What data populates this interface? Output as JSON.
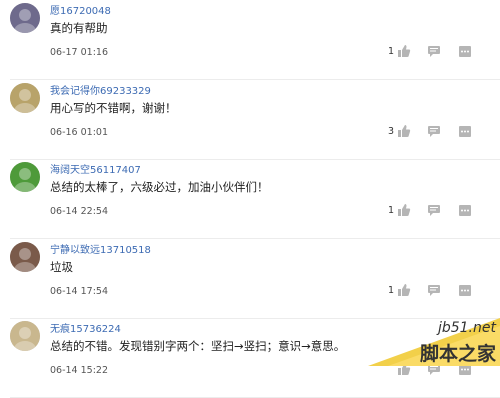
{
  "comments": [
    {
      "username": "愿16720048",
      "content": "真的有帮助",
      "time": "06-17 01:16",
      "likes": "1",
      "avatar_color": "#6e6a8c"
    },
    {
      "username": "我会记得你69233329",
      "content": "用心写的不错啊，谢谢！",
      "time": "06-16 01:01",
      "likes": "3",
      "avatar_color": "#b8a36a"
    },
    {
      "username": "海阔天空56117407",
      "content": "总结的太棒了，六级必过，加油小伙伴们！",
      "time": "06-14 22:54",
      "likes": "1",
      "avatar_color": "#4e9a3a"
    },
    {
      "username": "宁静以致远13710518",
      "content": "垃圾",
      "time": "06-14 17:54",
      "likes": "1",
      "avatar_color": "#7a5a4a"
    },
    {
      "username": "无痕15736224",
      "content": "总结的不错。发现错别字两个：坚扫→竖扫；意识→意思。",
      "time": "06-14 15:22",
      "likes": "",
      "avatar_color": "#c9b78e"
    }
  ],
  "watermark": {
    "site": "jb51.net",
    "name": "脚本之家"
  },
  "colors": {
    "username": "#3d6bb3",
    "icon": "#b5b5b5",
    "divider": "#ececec"
  }
}
